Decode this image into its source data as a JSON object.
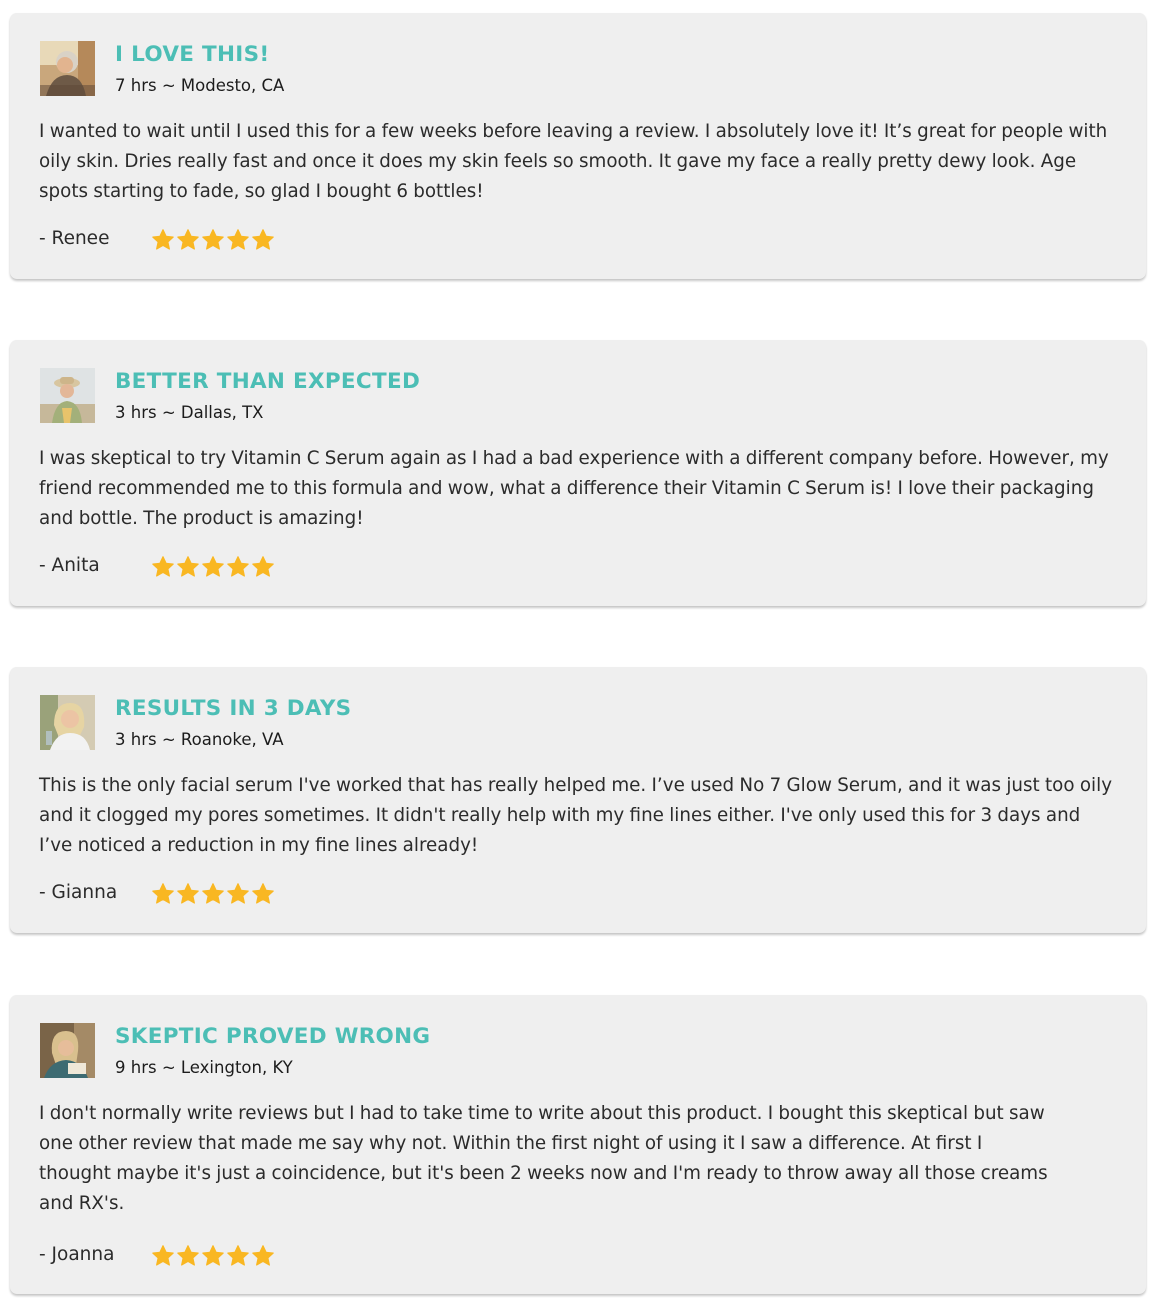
{
  "colors": {
    "accent": "#4cbeb5",
    "star": "#f9b722",
    "card_background": "#efefef",
    "text": "#2b2b2b"
  },
  "reviews": [
    {
      "avatar": "reviewer-photo",
      "title": "I LOVE THIS!",
      "meta": "7 hrs ~ Modesto, CA",
      "body": "I wanted to wait until I used this for a few weeks before leaving a review. I absolutely love it! It’s great for people with oily skin. Dries really fast and once it does my skin feels so smooth. It gave my face a really pretty dewy look. Age spots starting to fade, so glad I bought 6 bottles!",
      "author": "- Renee",
      "rating": 5
    },
    {
      "avatar": "reviewer-photo",
      "title": "BETTER THAN EXPECTED",
      "meta": "3 hrs ~ Dallas, TX",
      "body": "I was skeptical to try Vitamin C Serum again as I had a bad experience with a different company before. However, my friend recommended me to this formula and wow, what a difference their Vitamin C Serum is! I love their packaging and bottle. The product is amazing!",
      "author": "- Anita",
      "rating": 5
    },
    {
      "avatar": "reviewer-photo",
      "title": "RESULTS IN 3 DAYS",
      "meta": "3 hrs ~ Roanoke, VA",
      "body": "This is the only facial serum I've worked that has really helped me. I’ve used No 7 Glow Serum, and it was just too oily and it clogged my pores sometimes. It didn't really help with my fine lines either. I've only used this for 3 days and I’ve noticed a reduction in my fine lines already!",
      "author": "- Gianna",
      "rating": 5
    },
    {
      "avatar": "reviewer-photo",
      "title": "SKEPTIC PROVED WRONG",
      "meta": "9 hrs ~ Lexington, KY",
      "body": "I don't normally write reviews but I had to take time to write about this product. I bought this skeptical but saw one other review that made me say why not. Within the first night of using it I saw a difference. At first I thought maybe it's just a coincidence, but it's been 2 weeks now and I'm ready to throw away all those creams and RX's.",
      "author": "- Joanna",
      "rating": 5
    }
  ]
}
